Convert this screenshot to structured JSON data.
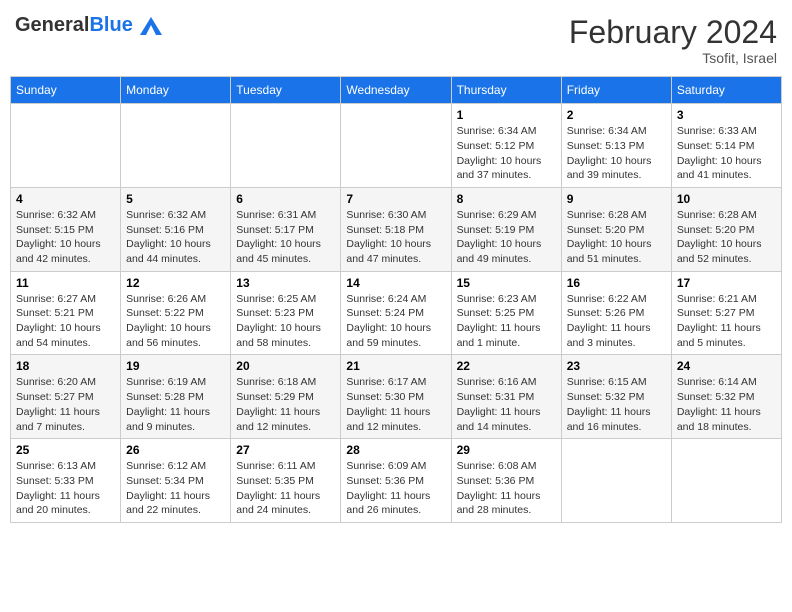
{
  "header": {
    "logo_general": "General",
    "logo_blue": "Blue",
    "month_year": "February 2024",
    "location": "Tsofit, Israel"
  },
  "days_of_week": [
    "Sunday",
    "Monday",
    "Tuesday",
    "Wednesday",
    "Thursday",
    "Friday",
    "Saturday"
  ],
  "weeks": [
    {
      "shaded": false,
      "days": [
        {
          "num": "",
          "info": ""
        },
        {
          "num": "",
          "info": ""
        },
        {
          "num": "",
          "info": ""
        },
        {
          "num": "",
          "info": ""
        },
        {
          "num": "1",
          "info": "Sunrise: 6:34 AM\nSunset: 5:12 PM\nDaylight: 10 hours and 37 minutes."
        },
        {
          "num": "2",
          "info": "Sunrise: 6:34 AM\nSunset: 5:13 PM\nDaylight: 10 hours and 39 minutes."
        },
        {
          "num": "3",
          "info": "Sunrise: 6:33 AM\nSunset: 5:14 PM\nDaylight: 10 hours and 41 minutes."
        }
      ]
    },
    {
      "shaded": true,
      "days": [
        {
          "num": "4",
          "info": "Sunrise: 6:32 AM\nSunset: 5:15 PM\nDaylight: 10 hours and 42 minutes."
        },
        {
          "num": "5",
          "info": "Sunrise: 6:32 AM\nSunset: 5:16 PM\nDaylight: 10 hours and 44 minutes."
        },
        {
          "num": "6",
          "info": "Sunrise: 6:31 AM\nSunset: 5:17 PM\nDaylight: 10 hours and 45 minutes."
        },
        {
          "num": "7",
          "info": "Sunrise: 6:30 AM\nSunset: 5:18 PM\nDaylight: 10 hours and 47 minutes."
        },
        {
          "num": "8",
          "info": "Sunrise: 6:29 AM\nSunset: 5:19 PM\nDaylight: 10 hours and 49 minutes."
        },
        {
          "num": "9",
          "info": "Sunrise: 6:28 AM\nSunset: 5:20 PM\nDaylight: 10 hours and 51 minutes."
        },
        {
          "num": "10",
          "info": "Sunrise: 6:28 AM\nSunset: 5:20 PM\nDaylight: 10 hours and 52 minutes."
        }
      ]
    },
    {
      "shaded": false,
      "days": [
        {
          "num": "11",
          "info": "Sunrise: 6:27 AM\nSunset: 5:21 PM\nDaylight: 10 hours and 54 minutes."
        },
        {
          "num": "12",
          "info": "Sunrise: 6:26 AM\nSunset: 5:22 PM\nDaylight: 10 hours and 56 minutes."
        },
        {
          "num": "13",
          "info": "Sunrise: 6:25 AM\nSunset: 5:23 PM\nDaylight: 10 hours and 58 minutes."
        },
        {
          "num": "14",
          "info": "Sunrise: 6:24 AM\nSunset: 5:24 PM\nDaylight: 10 hours and 59 minutes."
        },
        {
          "num": "15",
          "info": "Sunrise: 6:23 AM\nSunset: 5:25 PM\nDaylight: 11 hours and 1 minute."
        },
        {
          "num": "16",
          "info": "Sunrise: 6:22 AM\nSunset: 5:26 PM\nDaylight: 11 hours and 3 minutes."
        },
        {
          "num": "17",
          "info": "Sunrise: 6:21 AM\nSunset: 5:27 PM\nDaylight: 11 hours and 5 minutes."
        }
      ]
    },
    {
      "shaded": true,
      "days": [
        {
          "num": "18",
          "info": "Sunrise: 6:20 AM\nSunset: 5:27 PM\nDaylight: 11 hours and 7 minutes."
        },
        {
          "num": "19",
          "info": "Sunrise: 6:19 AM\nSunset: 5:28 PM\nDaylight: 11 hours and 9 minutes."
        },
        {
          "num": "20",
          "info": "Sunrise: 6:18 AM\nSunset: 5:29 PM\nDaylight: 11 hours and 12 minutes."
        },
        {
          "num": "21",
          "info": "Sunrise: 6:17 AM\nSunset: 5:30 PM\nDaylight: 11 hours and 12 minutes."
        },
        {
          "num": "22",
          "info": "Sunrise: 6:16 AM\nSunset: 5:31 PM\nDaylight: 11 hours and 14 minutes."
        },
        {
          "num": "23",
          "info": "Sunrise: 6:15 AM\nSunset: 5:32 PM\nDaylight: 11 hours and 16 minutes."
        },
        {
          "num": "24",
          "info": "Sunrise: 6:14 AM\nSunset: 5:32 PM\nDaylight: 11 hours and 18 minutes."
        }
      ]
    },
    {
      "shaded": false,
      "days": [
        {
          "num": "25",
          "info": "Sunrise: 6:13 AM\nSunset: 5:33 PM\nDaylight: 11 hours and 20 minutes."
        },
        {
          "num": "26",
          "info": "Sunrise: 6:12 AM\nSunset: 5:34 PM\nDaylight: 11 hours and 22 minutes."
        },
        {
          "num": "27",
          "info": "Sunrise: 6:11 AM\nSunset: 5:35 PM\nDaylight: 11 hours and 24 minutes."
        },
        {
          "num": "28",
          "info": "Sunrise: 6:09 AM\nSunset: 5:36 PM\nDaylight: 11 hours and 26 minutes."
        },
        {
          "num": "29",
          "info": "Sunrise: 6:08 AM\nSunset: 5:36 PM\nDaylight: 11 hours and 28 minutes."
        },
        {
          "num": "",
          "info": ""
        },
        {
          "num": "",
          "info": ""
        }
      ]
    }
  ]
}
